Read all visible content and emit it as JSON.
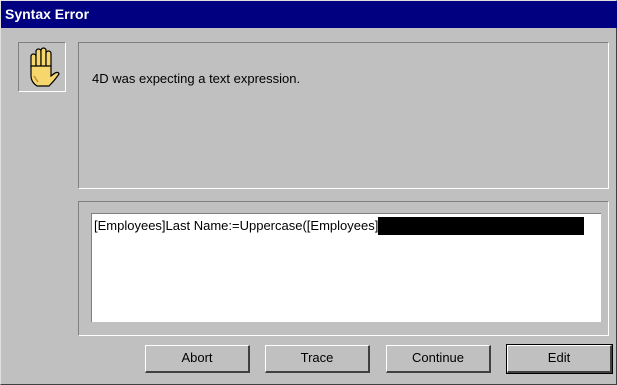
{
  "window": {
    "title": "Syntax Error"
  },
  "icon": {
    "name": "stop-hand-icon"
  },
  "message": {
    "text": "4D was expecting a text expression."
  },
  "code": {
    "line": "[Employees]Last Name:=Uppercase([Employees]",
    "selection": ""
  },
  "buttons": {
    "abort": "Abort",
    "trace": "Trace",
    "continue": "Continue",
    "edit": "Edit"
  },
  "colors": {
    "titlebar": "#000080",
    "face": "#c0c0c0",
    "selection": "#000000"
  }
}
